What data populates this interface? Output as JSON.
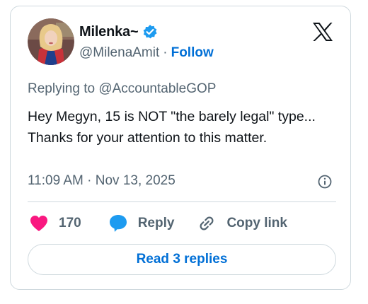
{
  "author": {
    "display_name": "Milenka~",
    "handle": "@MilenaAmit",
    "separator": "·",
    "follow_label": "Follow",
    "verified": true
  },
  "post": {
    "replying_to": "Replying to @AccountableGOP",
    "text": "Hey Megyn, 15 is NOT \"the barely legal\" type... Thanks for your attention to this matter.",
    "timestamp": "11:09 AM · Nov 13, 2025"
  },
  "actions": {
    "like_count": "170",
    "reply_label": "Reply",
    "copy_link_label": "Copy link"
  },
  "read_replies_label": "Read 3 replies",
  "icons": {
    "platform_logo": "x-logo-icon",
    "verified": "verified-badge-icon",
    "info": "info-icon",
    "like": "heart-icon",
    "reply": "speech-bubble-icon",
    "copy_link": "link-icon"
  },
  "colors": {
    "like": "#f91880",
    "reply": "#1d9bf0",
    "link": "#006fd6",
    "secondary_text": "#536471",
    "border": "#cfd9de"
  }
}
